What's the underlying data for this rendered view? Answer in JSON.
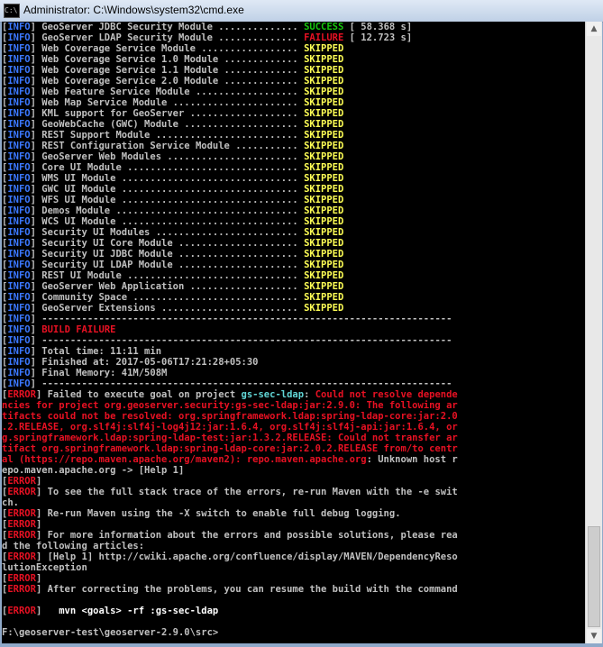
{
  "window": {
    "title": "Administrator: C:\\Windows\\system32\\cmd.exe",
    "icon": "cmd-icon",
    "icon_glyph": "C:\\"
  },
  "colors": {
    "background": "#000000",
    "text": "#c0c0c0",
    "info_tag": "#3b78ff",
    "success": "#16c60c",
    "failure": "#e81123",
    "skipped": "#ffff55",
    "module_link": "#61d6d6"
  },
  "console": {
    "lines": [
      [
        {
          "t": "[",
          "c": "w"
        },
        {
          "t": "INFO",
          "c": "bl"
        },
        {
          "t": "] GeoServer JDBC Security Module .............. ",
          "c": "w"
        },
        {
          "t": "SUCCESS",
          "c": "g"
        },
        {
          "t": " [ 58.368 s]",
          "c": "w"
        }
      ],
      [
        {
          "t": "[",
          "c": "w"
        },
        {
          "t": "INFO",
          "c": "bl"
        },
        {
          "t": "] GeoServer LDAP Security Module .............. ",
          "c": "w"
        },
        {
          "t": "FAILURE",
          "c": "r"
        },
        {
          "t": " [ 12.723 s]",
          "c": "w"
        }
      ],
      [
        {
          "t": "[",
          "c": "w"
        },
        {
          "t": "INFO",
          "c": "bl"
        },
        {
          "t": "] Web Coverage Service Module ................. ",
          "c": "w"
        },
        {
          "t": "SKIPPED",
          "c": "y"
        }
      ],
      [
        {
          "t": "[",
          "c": "w"
        },
        {
          "t": "INFO",
          "c": "bl"
        },
        {
          "t": "] Web Coverage Service 1.0 Module ............. ",
          "c": "w"
        },
        {
          "t": "SKIPPED",
          "c": "y"
        }
      ],
      [
        {
          "t": "[",
          "c": "w"
        },
        {
          "t": "INFO",
          "c": "bl"
        },
        {
          "t": "] Web Coverage Service 1.1 Module ............. ",
          "c": "w"
        },
        {
          "t": "SKIPPED",
          "c": "y"
        }
      ],
      [
        {
          "t": "[",
          "c": "w"
        },
        {
          "t": "INFO",
          "c": "bl"
        },
        {
          "t": "] Web Coverage Service 2.0 Module ............. ",
          "c": "w"
        },
        {
          "t": "SKIPPED",
          "c": "y"
        }
      ],
      [
        {
          "t": "[",
          "c": "w"
        },
        {
          "t": "INFO",
          "c": "bl"
        },
        {
          "t": "] Web Feature Service Module .................. ",
          "c": "w"
        },
        {
          "t": "SKIPPED",
          "c": "y"
        }
      ],
      [
        {
          "t": "[",
          "c": "w"
        },
        {
          "t": "INFO",
          "c": "bl"
        },
        {
          "t": "] Web Map Service Module ...................... ",
          "c": "w"
        },
        {
          "t": "SKIPPED",
          "c": "y"
        }
      ],
      [
        {
          "t": "[",
          "c": "w"
        },
        {
          "t": "INFO",
          "c": "bl"
        },
        {
          "t": "] KML support for GeoServer ................... ",
          "c": "w"
        },
        {
          "t": "SKIPPED",
          "c": "y"
        }
      ],
      [
        {
          "t": "[",
          "c": "w"
        },
        {
          "t": "INFO",
          "c": "bl"
        },
        {
          "t": "] GeoWebCache (GWC) Module .................... ",
          "c": "w"
        },
        {
          "t": "SKIPPED",
          "c": "y"
        }
      ],
      [
        {
          "t": "[",
          "c": "w"
        },
        {
          "t": "INFO",
          "c": "bl"
        },
        {
          "t": "] REST Support Module ......................... ",
          "c": "w"
        },
        {
          "t": "SKIPPED",
          "c": "y"
        }
      ],
      [
        {
          "t": "[",
          "c": "w"
        },
        {
          "t": "INFO",
          "c": "bl"
        },
        {
          "t": "] REST Configuration Service Module ........... ",
          "c": "w"
        },
        {
          "t": "SKIPPED",
          "c": "y"
        }
      ],
      [
        {
          "t": "[",
          "c": "w"
        },
        {
          "t": "INFO",
          "c": "bl"
        },
        {
          "t": "] GeoServer Web Modules ....................... ",
          "c": "w"
        },
        {
          "t": "SKIPPED",
          "c": "y"
        }
      ],
      [
        {
          "t": "[",
          "c": "w"
        },
        {
          "t": "INFO",
          "c": "bl"
        },
        {
          "t": "] Core UI Module .............................. ",
          "c": "w"
        },
        {
          "t": "SKIPPED",
          "c": "y"
        }
      ],
      [
        {
          "t": "[",
          "c": "w"
        },
        {
          "t": "INFO",
          "c": "bl"
        },
        {
          "t": "] WMS UI Module ............................... ",
          "c": "w"
        },
        {
          "t": "SKIPPED",
          "c": "y"
        }
      ],
      [
        {
          "t": "[",
          "c": "w"
        },
        {
          "t": "INFO",
          "c": "bl"
        },
        {
          "t": "] GWC UI Module ............................... ",
          "c": "w"
        },
        {
          "t": "SKIPPED",
          "c": "y"
        }
      ],
      [
        {
          "t": "[",
          "c": "w"
        },
        {
          "t": "INFO",
          "c": "bl"
        },
        {
          "t": "] WFS UI Module ............................... ",
          "c": "w"
        },
        {
          "t": "SKIPPED",
          "c": "y"
        }
      ],
      [
        {
          "t": "[",
          "c": "w"
        },
        {
          "t": "INFO",
          "c": "bl"
        },
        {
          "t": "] Demos Module ................................ ",
          "c": "w"
        },
        {
          "t": "SKIPPED",
          "c": "y"
        }
      ],
      [
        {
          "t": "[",
          "c": "w"
        },
        {
          "t": "INFO",
          "c": "bl"
        },
        {
          "t": "] WCS UI Module ............................... ",
          "c": "w"
        },
        {
          "t": "SKIPPED",
          "c": "y"
        }
      ],
      [
        {
          "t": "[",
          "c": "w"
        },
        {
          "t": "INFO",
          "c": "bl"
        },
        {
          "t": "] Security UI Modules ......................... ",
          "c": "w"
        },
        {
          "t": "SKIPPED",
          "c": "y"
        }
      ],
      [
        {
          "t": "[",
          "c": "w"
        },
        {
          "t": "INFO",
          "c": "bl"
        },
        {
          "t": "] Security UI Core Module ..................... ",
          "c": "w"
        },
        {
          "t": "SKIPPED",
          "c": "y"
        }
      ],
      [
        {
          "t": "[",
          "c": "w"
        },
        {
          "t": "INFO",
          "c": "bl"
        },
        {
          "t": "] Security UI JDBC Module ..................... ",
          "c": "w"
        },
        {
          "t": "SKIPPED",
          "c": "y"
        }
      ],
      [
        {
          "t": "[",
          "c": "w"
        },
        {
          "t": "INFO",
          "c": "bl"
        },
        {
          "t": "] Security UI LDAP Module ..................... ",
          "c": "w"
        },
        {
          "t": "SKIPPED",
          "c": "y"
        }
      ],
      [
        {
          "t": "[",
          "c": "w"
        },
        {
          "t": "INFO",
          "c": "bl"
        },
        {
          "t": "] REST UI Module .............................. ",
          "c": "w"
        },
        {
          "t": "SKIPPED",
          "c": "y"
        }
      ],
      [
        {
          "t": "[",
          "c": "w"
        },
        {
          "t": "INFO",
          "c": "bl"
        },
        {
          "t": "] GeoServer Web Application ................... ",
          "c": "w"
        },
        {
          "t": "SKIPPED",
          "c": "y"
        }
      ],
      [
        {
          "t": "[",
          "c": "w"
        },
        {
          "t": "INFO",
          "c": "bl"
        },
        {
          "t": "] Community Space ............................. ",
          "c": "w"
        },
        {
          "t": "SKIPPED",
          "c": "y"
        }
      ],
      [
        {
          "t": "[",
          "c": "w"
        },
        {
          "t": "INFO",
          "c": "bl"
        },
        {
          "t": "] GeoServer Extensions ........................ ",
          "c": "w"
        },
        {
          "t": "SKIPPED",
          "c": "y"
        }
      ],
      [
        {
          "t": "[",
          "c": "w"
        },
        {
          "t": "INFO",
          "c": "bl"
        },
        {
          "t": "] ------------------------------------------------------------------------",
          "c": "w"
        }
      ],
      [
        {
          "t": "[",
          "c": "w"
        },
        {
          "t": "INFO",
          "c": "bl"
        },
        {
          "t": "] ",
          "c": "w"
        },
        {
          "t": "BUILD FAILURE",
          "c": "r"
        }
      ],
      [
        {
          "t": "[",
          "c": "w"
        },
        {
          "t": "INFO",
          "c": "bl"
        },
        {
          "t": "] ------------------------------------------------------------------------",
          "c": "w"
        }
      ],
      [
        {
          "t": "[",
          "c": "w"
        },
        {
          "t": "INFO",
          "c": "bl"
        },
        {
          "t": "] Total time: 11:11 min",
          "c": "w"
        }
      ],
      [
        {
          "t": "[",
          "c": "w"
        },
        {
          "t": "INFO",
          "c": "bl"
        },
        {
          "t": "] Finished at: 2017-05-06T17:21:28+05:30",
          "c": "w"
        }
      ],
      [
        {
          "t": "[",
          "c": "w"
        },
        {
          "t": "INFO",
          "c": "bl"
        },
        {
          "t": "] Final Memory: 41M/508M",
          "c": "w"
        }
      ],
      [
        {
          "t": "[",
          "c": "w"
        },
        {
          "t": "INFO",
          "c": "bl"
        },
        {
          "t": "] ------------------------------------------------------------------------",
          "c": "w"
        }
      ],
      [
        {
          "t": "[",
          "c": "w"
        },
        {
          "t": "ERROR",
          "c": "r"
        },
        {
          "t": "] Failed to execute goal on project ",
          "c": "w"
        },
        {
          "t": "gs-sec-ldap",
          "c": "c"
        },
        {
          "t": ": ",
          "c": "w"
        },
        {
          "t": "Could not resolve depende",
          "c": "r"
        }
      ],
      [
        {
          "t": "ncies for project org.geoserver.security:gs-sec-ldap:jar:2.9.0: The following ar",
          "c": "r"
        }
      ],
      [
        {
          "t": "tifacts could not be resolved: org.springframework.ldap:spring-ldap-core:jar:2.0",
          "c": "r"
        }
      ],
      [
        {
          "t": ".2.RELEASE, org.slf4j:slf4j-log4j12:jar:1.6.4, org.slf4j:slf4j-api:jar:1.6.4, or",
          "c": "r"
        }
      ],
      [
        {
          "t": "g.springframework.ldap:spring-ldap-test:jar:1.3.2.RELEASE: Could not transfer ar",
          "c": "r"
        }
      ],
      [
        {
          "t": "tifact org.springframework.ldap:spring-ldap-core:jar:2.0.2.RELEASE from/to centr",
          "c": "r"
        }
      ],
      [
        {
          "t": "al (https://repo.maven.apache.org/maven2): repo.maven.apache.org",
          "c": "r"
        },
        {
          "t": ": Unknown host r",
          "c": "w"
        }
      ],
      [
        {
          "t": "epo.maven.apache.org -> [Help 1]",
          "c": "w"
        }
      ],
      [
        {
          "t": "[",
          "c": "w"
        },
        {
          "t": "ERROR",
          "c": "r"
        },
        {
          "t": "]",
          "c": "w"
        }
      ],
      [
        {
          "t": "[",
          "c": "w"
        },
        {
          "t": "ERROR",
          "c": "r"
        },
        {
          "t": "] To see the full stack trace of the errors, re-run Maven with the -e swit",
          "c": "w"
        }
      ],
      [
        {
          "t": "ch.",
          "c": "w"
        }
      ],
      [
        {
          "t": "[",
          "c": "w"
        },
        {
          "t": "ERROR",
          "c": "r"
        },
        {
          "t": "] Re-run Maven using the -X switch to enable full debug logging.",
          "c": "w"
        }
      ],
      [
        {
          "t": "[",
          "c": "w"
        },
        {
          "t": "ERROR",
          "c": "r"
        },
        {
          "t": "]",
          "c": "w"
        }
      ],
      [
        {
          "t": "[",
          "c": "w"
        },
        {
          "t": "ERROR",
          "c": "r"
        },
        {
          "t": "] For more information about the errors and possible solutions, please rea",
          "c": "w"
        }
      ],
      [
        {
          "t": "d the following articles:",
          "c": "w"
        }
      ],
      [
        {
          "t": "[",
          "c": "w"
        },
        {
          "t": "ERROR",
          "c": "r"
        },
        {
          "t": "] [Help 1] http://cwiki.apache.org/confluence/display/MAVEN/DependencyReso",
          "c": "w"
        }
      ],
      [
        {
          "t": "lutionException",
          "c": "w"
        }
      ],
      [
        {
          "t": "[",
          "c": "w"
        },
        {
          "t": "ERROR",
          "c": "r"
        },
        {
          "t": "]",
          "c": "w"
        }
      ],
      [
        {
          "t": "[",
          "c": "w"
        },
        {
          "t": "ERROR",
          "c": "r"
        },
        {
          "t": "] After correcting the problems, you can resume the build with the command",
          "c": "w"
        }
      ],
      [
        {
          "t": "",
          "c": "w"
        }
      ],
      [
        {
          "t": "[",
          "c": "w"
        },
        {
          "t": "ERROR",
          "c": "r"
        },
        {
          "t": "]   ",
          "c": "w"
        },
        {
          "t": "mvn <goals> -rf :gs-sec-ldap",
          "c": "bw"
        }
      ],
      [
        {
          "t": "",
          "c": "w"
        }
      ],
      [
        {
          "t": "F:\\geoserver-test\\geoserver-2.9.0\\src>",
          "c": "w"
        }
      ]
    ]
  }
}
